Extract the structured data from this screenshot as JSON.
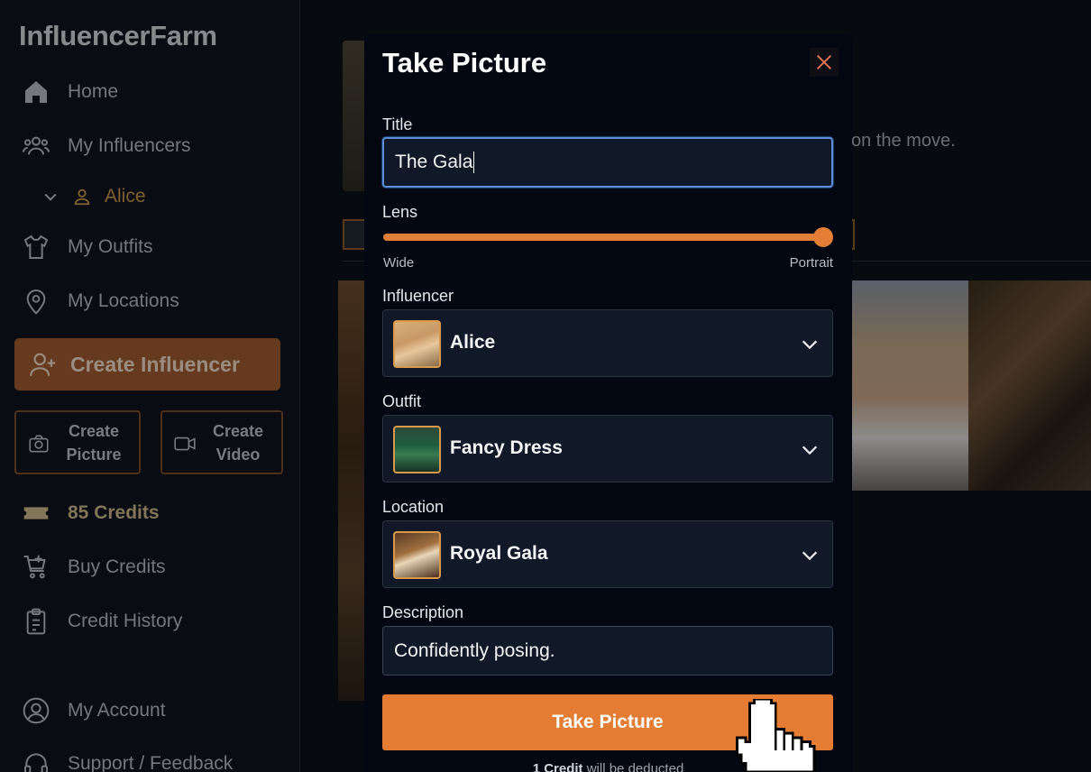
{
  "app": {
    "name": "InfluencerFarm"
  },
  "sidebar": {
    "items": [
      {
        "label": "Home",
        "icon": "home-icon"
      },
      {
        "label": "My Influencers",
        "icon": "users-icon"
      },
      {
        "label": "Alice",
        "icon": "user-icon",
        "sub": true
      },
      {
        "label": "My Outfits",
        "icon": "shirt-icon"
      },
      {
        "label": "My Locations",
        "icon": "map-pin-icon"
      }
    ],
    "create_influencer": "Create Influencer",
    "create_picture": [
      "Create",
      "Picture"
    ],
    "create_video": [
      "Create",
      "Video"
    ],
    "credits": "85 Credits",
    "buy_credits": "Buy Credits",
    "credit_history": "Credit History",
    "my_account": "My Account",
    "support": "Support / Feedback"
  },
  "background": {
    "tagline_fragment": "on the move."
  },
  "modal": {
    "title": "Take Picture",
    "title_label": "Title",
    "title_value": "The Gala",
    "lens_label": "Lens",
    "lens_min": "Wide",
    "lens_max": "Portrait",
    "lens_value": 1.0,
    "influencer_label": "Influencer",
    "influencer_value": "Alice",
    "outfit_label": "Outfit",
    "outfit_value": "Fancy Dress",
    "location_label": "Location",
    "location_value": "Royal Gala",
    "description_label": "Description",
    "description_value": "Confidently posing.",
    "submit": "Take Picture",
    "footnote_bold": "1 Credit",
    "footnote_rest": " will be deducted"
  },
  "colors": {
    "accent": "#e57c34",
    "sidebar_bg": "#0e131c",
    "modal_bg": "#030712"
  }
}
